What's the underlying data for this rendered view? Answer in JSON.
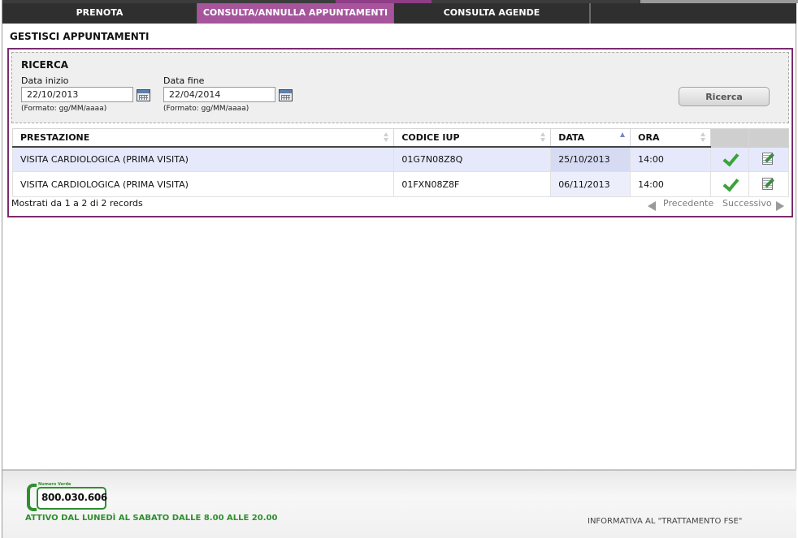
{
  "nav": {
    "tabs": [
      {
        "label": "PRENOTA"
      },
      {
        "label": "CONSULTA/ANNULLA APPUNTAMENTI"
      },
      {
        "label": "CONSULTA AGENDE"
      }
    ],
    "active_tab": "CONSULTA/ANNULLA APPUNTAMENTI"
  },
  "page": {
    "title": "GESTISCI APPUNTAMENTI"
  },
  "search": {
    "title": "RICERCA",
    "start_label": "Data inizio",
    "start_value": "22/10/2013",
    "start_format": "(Formato: gg/MM/aaaa)",
    "end_label": "Data fine",
    "end_value": "22/04/2014",
    "end_format": "(Formato: gg/MM/aaaa)",
    "button_label": "Ricerca"
  },
  "table": {
    "columns": [
      "PRESTAZIONE",
      "CODICE IUP",
      "DATA",
      "ORA"
    ],
    "sorted_column": "DATA",
    "rows": [
      {
        "prestazione": "VISITA CARDIOLOGICA (PRIMA VISITA)",
        "codice": "01G7N08Z8Q",
        "data": "25/10/2013",
        "ora": "14:00"
      },
      {
        "prestazione": "VISITA CARDIOLOGICA (PRIMA VISITA)",
        "codice": "01FXN08Z8F",
        "data": "06/11/2013",
        "ora": "14:00"
      }
    ]
  },
  "pagination": {
    "info": "Mostrati da 1 a 2 di 2 records",
    "prev": "Precedente",
    "next": "Successivo"
  },
  "footer": {
    "numero_verde_tag": "Numero Verde",
    "phone": "800.030.606",
    "hours": "ATTIVO DAL LUNEDÌ AL SABATO DALLE 8.00 ALLE 20.00",
    "privacy_link": "INFORMATIVA AL \"TRATTAMENTO FSE\""
  },
  "colors": {
    "accent": "#a6559c",
    "panel_border": "#7a2c6f",
    "nav_bg": "#2f2f2f",
    "green": "#2f8f2f"
  },
  "icons": [
    "calendar-icon",
    "checkmark-icon",
    "edit-note-icon",
    "arrow-left-icon",
    "arrow-right-icon",
    "phone-icon"
  ]
}
